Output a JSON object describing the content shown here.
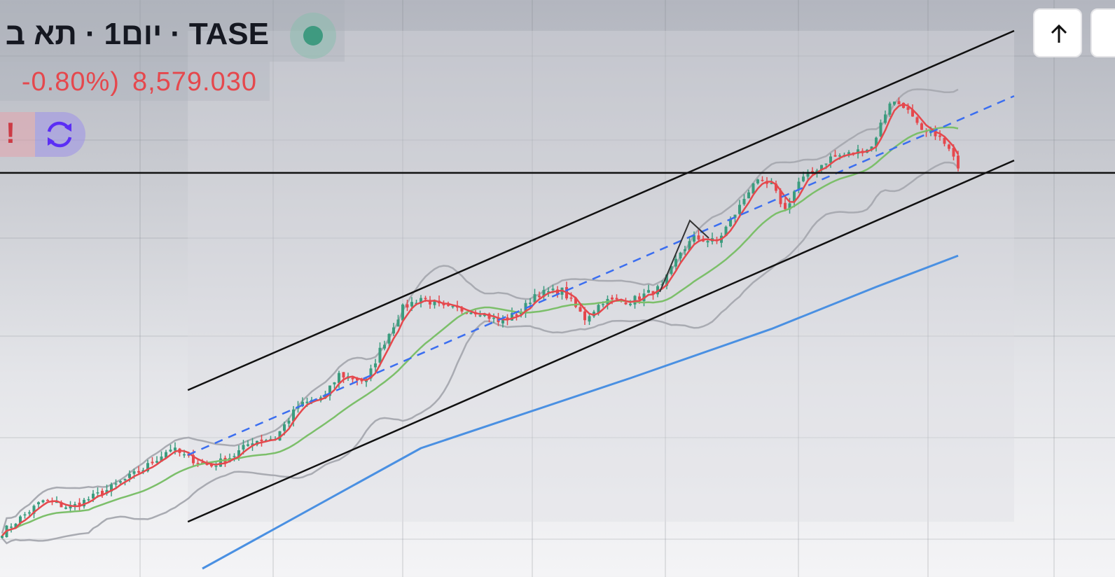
{
  "header": {
    "title_parts": [
      "תא ב",
      "·",
      "1יום",
      "·",
      "TASE"
    ],
    "change_percent": "-0.80%)",
    "last_price": "8,579.030",
    "status_color": "#3f9a80"
  },
  "icons": {
    "alert": "exclamation-icon",
    "refresh": "refresh-icon",
    "scroll": "arrow-up-icon"
  },
  "alert_glyph": "!",
  "colors": {
    "up": "#3b9c7e",
    "down": "#e5484d",
    "ma_fast": "#e5484d",
    "ma_slow": "#7cbf6a",
    "bands": "#a9abb2",
    "long_ma": "#4a90e2",
    "trend_mid": "#3b6ef0",
    "channel": "#111111"
  },
  "chart_data": {
    "type": "candlestick",
    "symbol": "TASE",
    "interval": "1D",
    "price_range": [
      7558,
      9000
    ],
    "close_anchors": [
      [
        0,
        7670
      ],
      [
        9,
        7749
      ],
      [
        15,
        7731
      ],
      [
        23,
        7775
      ],
      [
        31,
        7828
      ],
      [
        37,
        7880
      ],
      [
        41,
        7854
      ],
      [
        46,
        7836
      ],
      [
        51,
        7863
      ],
      [
        55,
        7898
      ],
      [
        60,
        7906
      ],
      [
        65,
        7985
      ],
      [
        71,
        8011
      ],
      [
        74,
        8064
      ],
      [
        80,
        8046
      ],
      [
        83,
        8125
      ],
      [
        88,
        8230
      ],
      [
        92,
        8256
      ],
      [
        97,
        8230
      ],
      [
        105,
        8221
      ],
      [
        109,
        8195
      ],
      [
        114,
        8221
      ],
      [
        117,
        8265
      ],
      [
        123,
        8274
      ],
      [
        128,
        8204
      ],
      [
        132,
        8248
      ],
      [
        138,
        8248
      ],
      [
        145,
        8283
      ],
      [
        149,
        8370
      ],
      [
        152,
        8405
      ],
      [
        157,
        8396
      ],
      [
        162,
        8484
      ],
      [
        165,
        8545
      ],
      [
        169,
        8536
      ],
      [
        172,
        8475
      ],
      [
        175,
        8545
      ],
      [
        182,
        8606
      ],
      [
        186,
        8615
      ],
      [
        191,
        8633
      ],
      [
        195,
        8746
      ],
      [
        198,
        8738
      ],
      [
        202,
        8668
      ],
      [
        205,
        8668
      ],
      [
        208,
        8624
      ],
      [
        210,
        8579.03
      ]
    ],
    "long_ma": [
      [
        44,
        7579
      ],
      [
        92,
        7880
      ],
      [
        138,
        8055
      ],
      [
        169,
        8178
      ],
      [
        192,
        8283
      ],
      [
        210,
        8361
      ]
    ],
    "channel_upper": [
      [
        40.8,
        8025
      ],
      [
        222.3,
        8923
      ]
    ],
    "channel_lower": [
      [
        40.8,
        7696
      ],
      [
        222.3,
        8599
      ]
    ],
    "channel_mid": [
      [
        40.8,
        7863
      ],
      [
        222.3,
        8760
      ]
    ],
    "horizontal_level": 8568,
    "indicators": [
      "SMA 5",
      "SMA 20",
      "Bollinger Bands 20,2",
      "Long SMA"
    ]
  }
}
